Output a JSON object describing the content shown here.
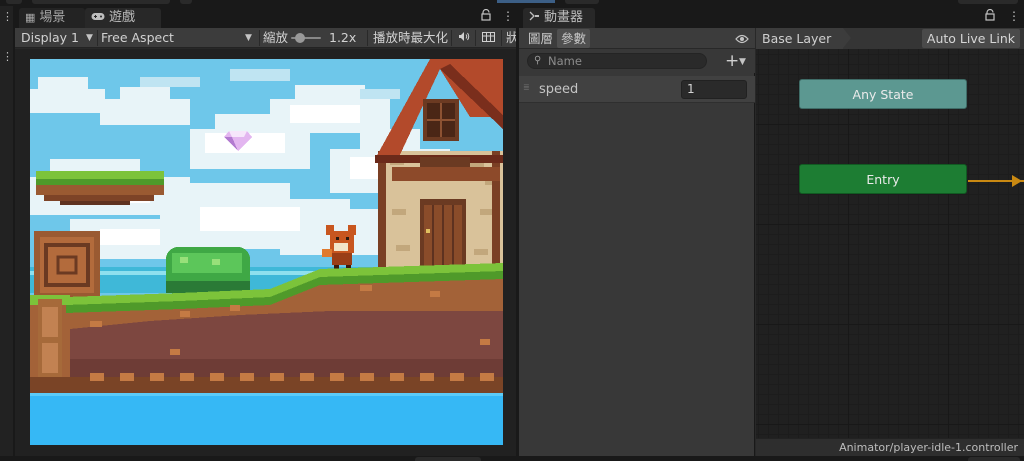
{
  "scene_tab": {
    "label": "場景",
    "icon": "grid-icon"
  },
  "game_tab": {
    "label": "遊戲",
    "icon": "gamepad-icon"
  },
  "game_toolbar": {
    "display": "Display 1",
    "aspect": "Free Aspect",
    "scale_label": "縮放",
    "scale_value": "1.2x",
    "scale_fraction": 0.2,
    "maximize_label": "播放時最大化",
    "truncated_label": "狀"
  },
  "animator_tab": {
    "label": "動畫器",
    "icon": "animator-icon"
  },
  "animator": {
    "layers_tab": "圖層",
    "params_tab": "參數",
    "search_placeholder": "Name",
    "parameters": [
      {
        "name": "speed",
        "value": "1"
      }
    ],
    "breadcrumb": "Base Layer",
    "auto_live_link": "Auto Live Link",
    "nodes": {
      "any_state": "Any State",
      "entry": "Entry"
    },
    "status_path": "Animator/player-idle-1.controller"
  },
  "colors": {
    "any_state": "#5c9891",
    "entry": "#1d7d33",
    "transition": "#c98912",
    "sky": "#6ec7ea",
    "water": "#36b8f5"
  }
}
